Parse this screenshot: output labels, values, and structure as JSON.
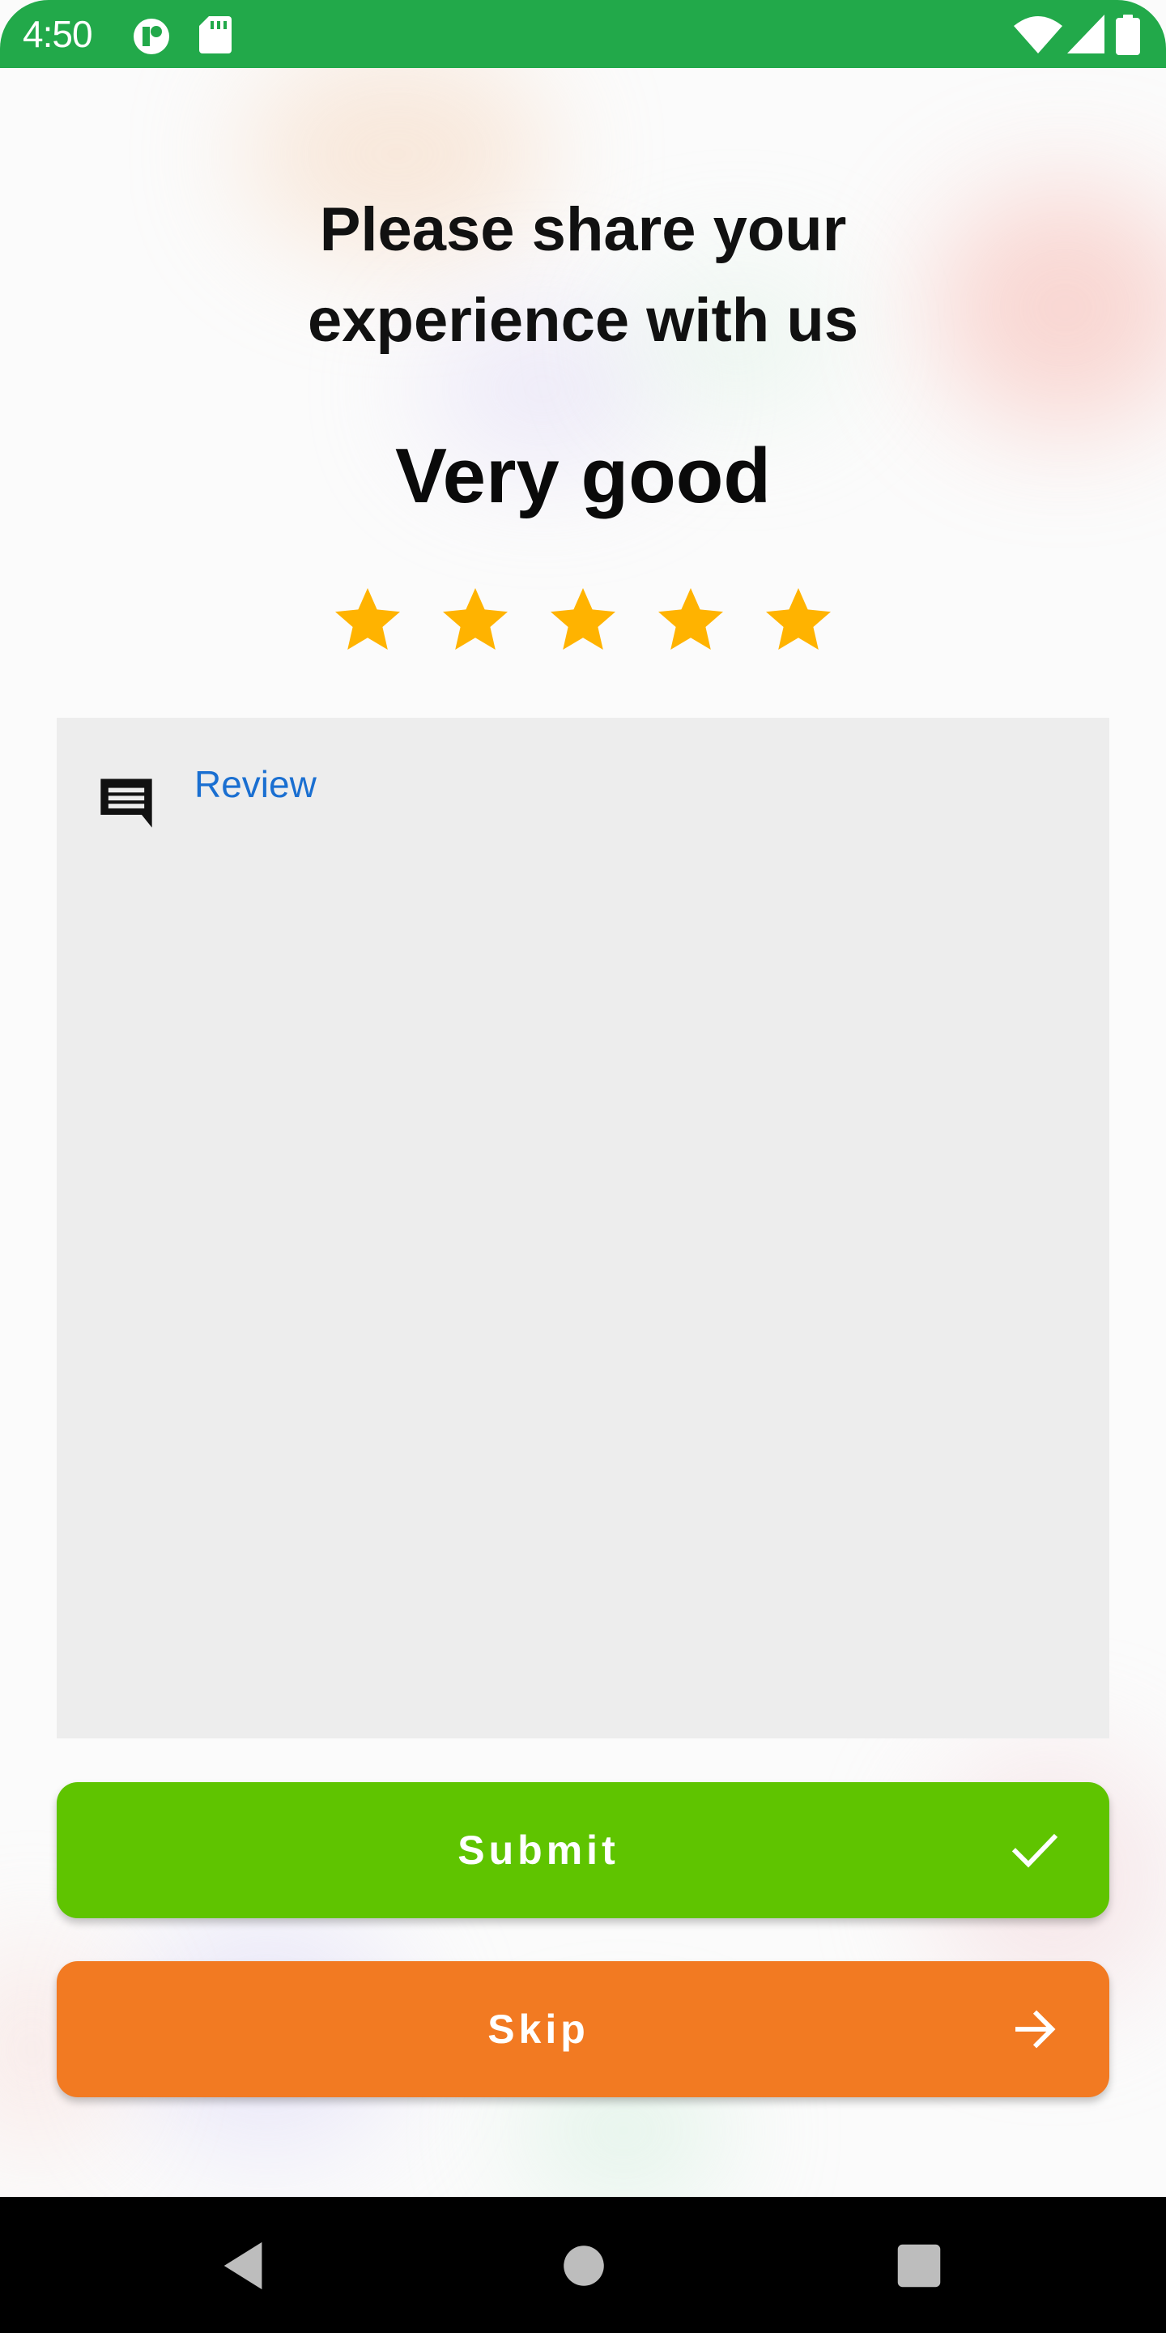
{
  "status_bar": {
    "time": "4:50",
    "background": "#22a94a",
    "left_icons": [
      "data-saver-icon",
      "sd-card-icon"
    ],
    "right_icons": [
      "wifi-icon",
      "cell-signal-icon",
      "battery-icon"
    ]
  },
  "rating": {
    "title": "Please share your\nexperience with us",
    "label": "Very good",
    "stars_total": 5,
    "stars_filled": 5,
    "star_color": "#ffb300"
  },
  "review": {
    "label": "Review",
    "icon": "comment-icon",
    "value": "",
    "label_color": "#1a6fd1"
  },
  "buttons": {
    "submit": {
      "label": "Submit",
      "icon": "check-icon",
      "color": "#5fc400"
    },
    "skip": {
      "label": "Skip",
      "icon": "arrow-right-icon",
      "color": "#f27a22"
    }
  },
  "nav_bar": {
    "items": [
      "back-icon",
      "home-icon",
      "recents-icon"
    ]
  }
}
